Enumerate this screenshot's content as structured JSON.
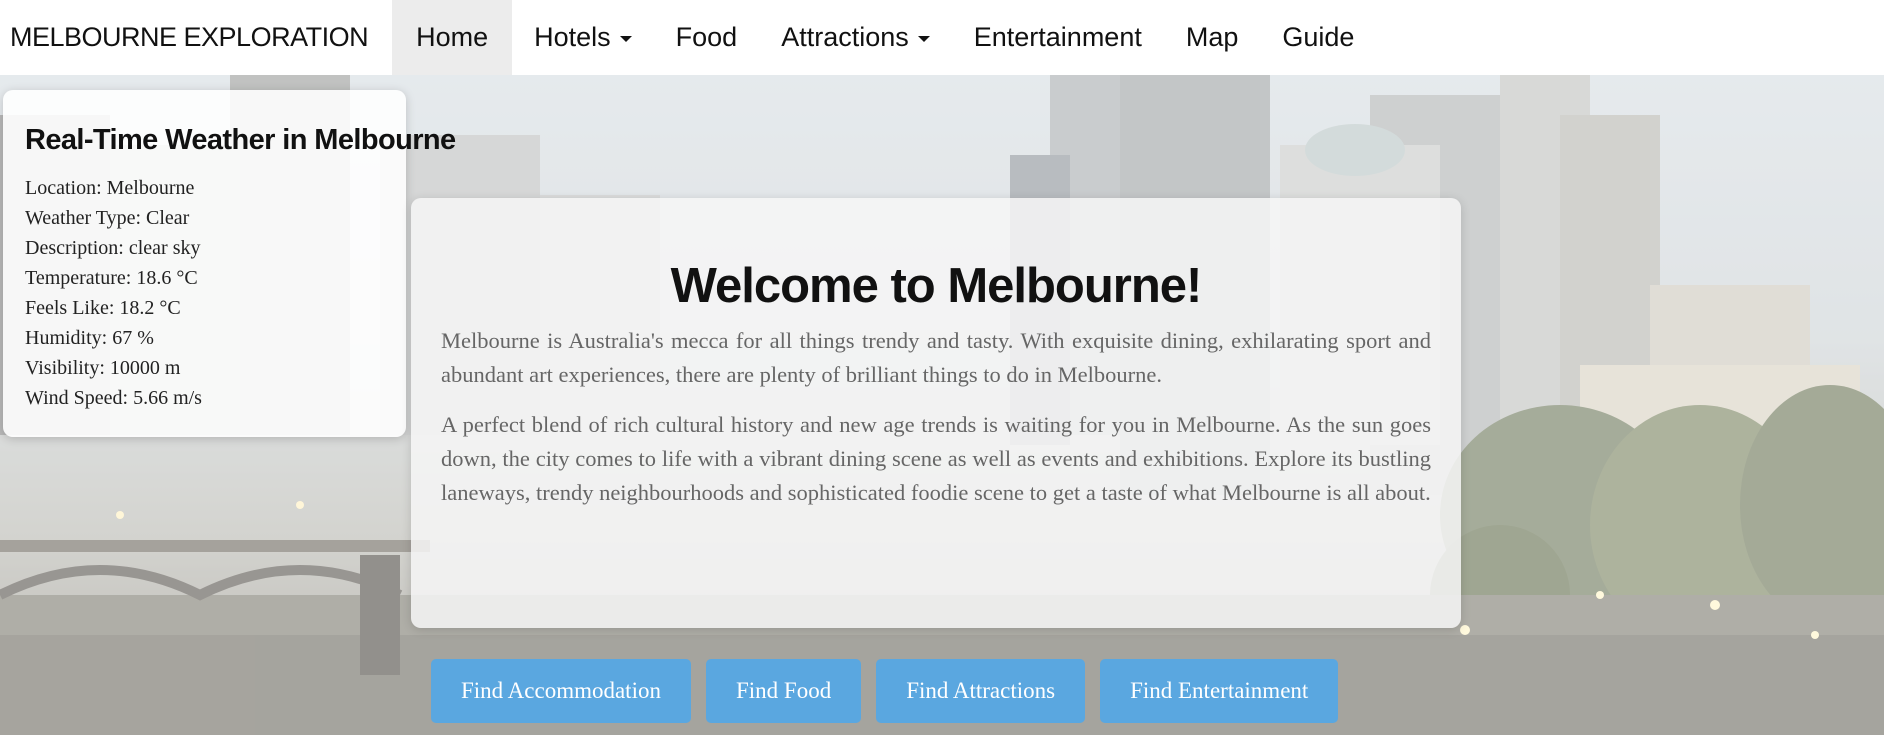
{
  "navbar": {
    "brand": "MELBOURNE EXPLORATION",
    "items": [
      {
        "label": "Home",
        "active": true,
        "dropdown": false
      },
      {
        "label": "Hotels",
        "active": false,
        "dropdown": true
      },
      {
        "label": "Food",
        "active": false,
        "dropdown": false
      },
      {
        "label": "Attractions",
        "active": false,
        "dropdown": true
      },
      {
        "label": "Entertainment",
        "active": false,
        "dropdown": false
      },
      {
        "label": "Map",
        "active": false,
        "dropdown": false
      },
      {
        "label": "Guide",
        "active": false,
        "dropdown": false
      }
    ]
  },
  "weather": {
    "title": "Real-Time Weather in Melbourne",
    "lines": [
      "Location: Melbourne",
      "Weather Type: Clear",
      "Description: clear sky",
      "Temperature: 18.6 °C",
      "Feels Like: 18.2 °C",
      "Humidity: 67 %",
      "Visibility: 10000 m",
      "Wind Speed: 5.66 m/s"
    ]
  },
  "welcome": {
    "title": "Welcome to Melbourne!",
    "paragraphs": [
      "Melbourne is Australia's mecca for all things trendy and tasty. With exquisite dining, exhilarating sport and abundant art experiences, there are plenty of brilliant things to do in Melbourne.",
      "A perfect blend of rich cultural history and new age trends is waiting for you in Melbourne. As the sun goes down, the city comes to life with a vibrant dining scene as well as events and exhibitions. Explore its bustling laneways, trendy neighbourhoods and sophisticated foodie scene to get a taste of what Melbourne is all about."
    ]
  },
  "actions": [
    "Find Accommodation",
    "Find Food",
    "Find Attractions",
    "Find Entertainment"
  ],
  "colors": {
    "button": "#5aa7e0",
    "active_nav": "#ececec"
  }
}
